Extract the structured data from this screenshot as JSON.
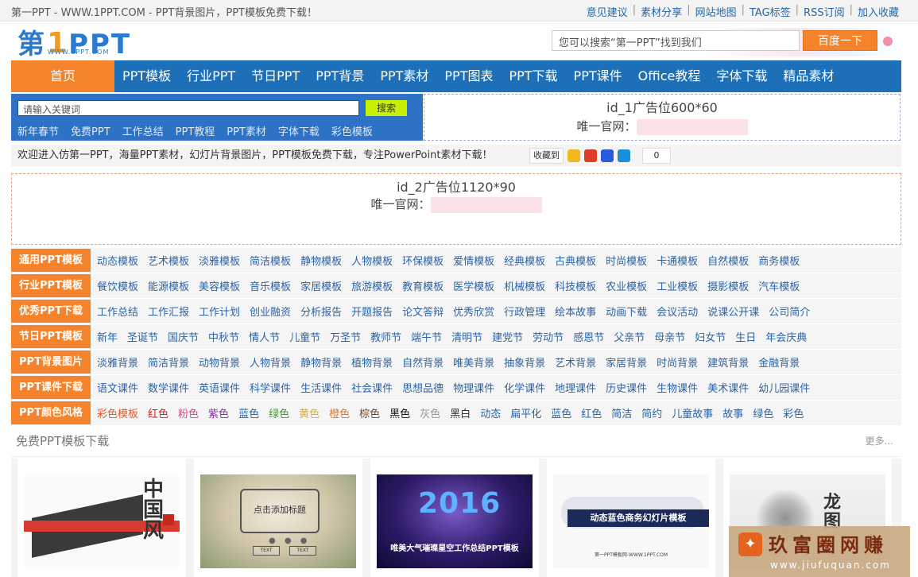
{
  "topbar": {
    "title": "第一PPT - WWW.1PPT.COM - PPT背景图片，PPT模板免费下载！",
    "links": [
      "意见建议",
      "素材分享",
      "网站地图",
      "TAG标签",
      "RSS订阅",
      "加入收藏"
    ]
  },
  "logo": {
    "part1": "第",
    "part2": "1",
    "part3": "PPT",
    "url": "WWW.1PPT.COM"
  },
  "search": {
    "placeholder": "您可以搜索“第一PPT”找到我们",
    "button": "百度一下"
  },
  "nav": {
    "home": "首页",
    "items": [
      "PPT模板",
      "行业PPT",
      "节日PPT",
      "PPT背景",
      "PPT素材",
      "PPT图表",
      "PPT下载",
      "PPT课件",
      "Office教程",
      "字体下载",
      "精品素材"
    ]
  },
  "subsearch": {
    "placeholder": "请输入关键词",
    "button": "搜索",
    "hot": [
      "新年春节",
      "免费PPT",
      "工作总结",
      "PPT教程",
      "PPT素材",
      "字体下载",
      "彩色模板"
    ]
  },
  "ad1": {
    "title": "id_1广告位600*60",
    "url_label": "唯一官网："
  },
  "welcome": {
    "message": "欢迎进入仿第一PPT，海量PPT素材，幻灯片背景图片，PPT模板免费下载，专注PowerPoint素材下载！",
    "fav": "收藏到",
    "count": "0"
  },
  "ad2": {
    "title": "id_2广告位1120*90",
    "url_label": "唯一官网："
  },
  "categories": [
    {
      "label": "通用PPT模板",
      "items": [
        "动态模板",
        "艺术模板",
        "淡雅模板",
        "简洁模板",
        "静物模板",
        "人物模板",
        "环保模板",
        "爱情模板",
        "经典模板",
        "古典模板",
        "时尚模板",
        "卡通模板",
        "自然模板",
        "商务模板"
      ]
    },
    {
      "label": "行业PPT模板",
      "items": [
        "餐饮模板",
        "能源模板",
        "美容模板",
        "音乐模板",
        "家居模板",
        "旅游模板",
        "教育模板",
        "医学模板",
        "机械模板",
        "科技模板",
        "农业模板",
        "工业模板",
        "摄影模板",
        "汽车模板"
      ]
    },
    {
      "label": "优秀PPT下载",
      "items": [
        "工作总结",
        "工作汇报",
        "工作计划",
        "创业融资",
        "分析报告",
        "开题报告",
        "论文答辩",
        "优秀欣赏",
        "行政管理",
        "绘本故事",
        "动画下载",
        "会议活动",
        "说课公开课",
        "公司简介"
      ]
    },
    {
      "label": "节日PPT模板",
      "items": [
        "新年",
        "圣诞节",
        "国庆节",
        "中秋节",
        "情人节",
        "儿童节",
        "万圣节",
        "教师节",
        "端午节",
        "清明节",
        "建党节",
        "劳动节",
        "感恩节",
        "父亲节",
        "母亲节",
        "妇女节",
        "生日",
        "年会庆典"
      ]
    },
    {
      "label": "PPT背景图片",
      "items": [
        "淡雅背景",
        "简洁背景",
        "动物背景",
        "人物背景",
        "静物背景",
        "植物背景",
        "自然背景",
        "唯美背景",
        "抽象背景",
        "艺术背景",
        "家居背景",
        "时尚背景",
        "建筑背景",
        "金融背景"
      ]
    },
    {
      "label": "PPT课件下载",
      "items": [
        "语文课件",
        "数学课件",
        "英语课件",
        "科学课件",
        "生活课件",
        "社会课件",
        "思想品德",
        "物理课件",
        "化学课件",
        "地理课件",
        "历史课件",
        "生物课件",
        "美术课件",
        "幼儿园课件"
      ]
    },
    {
      "label": "PPT颜色风格",
      "items": [
        "彩色模板",
        "红色",
        "粉色",
        "紫色",
        "蓝色",
        "绿色",
        "黄色",
        "橙色",
        "棕色",
        "黑色",
        "灰色",
        "黑白",
        "动态",
        "扁平化",
        "蓝色",
        "红色",
        "简洁",
        "简约",
        "儿童故事",
        "故事",
        "绿色",
        "彩色"
      ],
      "colors": [
        "#e05a2a",
        "#d42020",
        "#e0418f",
        "#8a2aa8",
        "#2466a8",
        "#3a9a2a",
        "#e0b020",
        "#e07a20",
        "#6b4a2a",
        "#111111",
        "#999999",
        "#333333",
        "#2a64a8",
        "#2a64a8",
        "#2a64a8",
        "#2a64a8",
        "#2a64a8",
        "#2a64a8",
        "#2a64a8",
        "#2a64a8",
        "#2a64a8",
        "#2a64a8"
      ]
    }
  ],
  "free": {
    "heading": "免费PPT模板下载",
    "more": "更多..."
  },
  "thumbs": [
    {
      "name": "中国风",
      "text": "中国风"
    },
    {
      "name": "点击添加标题",
      "text": "点击添加标题",
      "b1": "TEXT",
      "b2": "TEXT"
    },
    {
      "name": "2016",
      "text": "2016",
      "caption": "唯美大气璀璨星空工作总结PPT模板"
    },
    {
      "name": "动态蓝色商务幻灯片模板",
      "text": "动态蓝色商务幻灯片模板",
      "small": "第一PPT模板网-WWW.1PPT.COM"
    },
    {
      "name": "龙图",
      "text": "龙图"
    }
  ],
  "watermark": {
    "cn": "玖富圈网赚",
    "en": "www.jiufuquan.com"
  },
  "colors": {
    "accent": "#f5832b",
    "nav": "#1d70b8",
    "link": "#2a64a8"
  }
}
